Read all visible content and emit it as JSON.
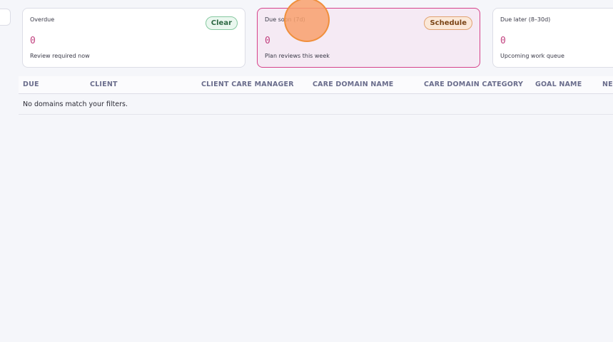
{
  "cards": {
    "overdue": {
      "title": "Overdue",
      "count": "0",
      "subtitle": "Review required now",
      "action": "Clear"
    },
    "due_soon": {
      "title": "Due soon (7d)",
      "count": "0",
      "subtitle": "Plan reviews this week",
      "action": "Schedule"
    },
    "due_later": {
      "title": "Due later (8–30d)",
      "count": "0",
      "subtitle": "Upcoming work queue"
    }
  },
  "table": {
    "columns": [
      "DUE",
      "CLIENT",
      "CLIENT CARE MANAGER",
      "CARE DOMAIN NAME",
      "CARE DOMAIN CATEGORY",
      "GOAL NAME",
      "NEXT"
    ],
    "empty_message": "No domains match your filters."
  },
  "colors": {
    "accent": "#d6428a",
    "count": "#c2417f",
    "clear_badge": "#eaf7ef",
    "schedule_badge": "#fbe8d8",
    "cursor": "#f08f3c"
  }
}
